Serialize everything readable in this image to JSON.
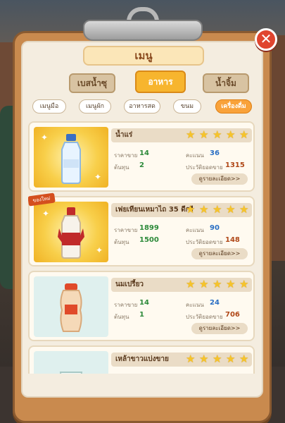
{
  "menu": {
    "title": "เมนู"
  },
  "tabs": [
    {
      "label": "เบสน้ำซุ"
    },
    {
      "label": "อาหาร"
    },
    {
      "label": "น้ำจิ้ม"
    }
  ],
  "active_tab": "อาหาร",
  "chips": [
    {
      "label": "เมนูมือ"
    },
    {
      "label": "เมนูผัก"
    },
    {
      "label": "อาหารสด"
    },
    {
      "label": "ขนม"
    },
    {
      "label": "เครื่องดื่ม"
    }
  ],
  "active_chip": "เครื่องดื่ม",
  "labels": {
    "price": "ราคาขาย",
    "cost": "ต้นทุน",
    "score": "คะแนน",
    "history": "ประวัติยอดขาย",
    "detail": "ดูรายละเอียด>>",
    "new_badge": "ของใหม่"
  },
  "items": [
    {
      "name": "น้ำแร่",
      "price": "14",
      "cost": "2",
      "score": "36",
      "sales": "1315",
      "stars": 5
    },
    {
      "name": "เฟยเทียนเหมาไถ 35 ดีกรี",
      "price": "1899",
      "cost": "1500",
      "score": "90",
      "sales": "148",
      "stars": 5
    },
    {
      "name": "นมเปรี้ยว",
      "price": "14",
      "cost": "1",
      "score": "24",
      "sales": "706",
      "stars": 5
    },
    {
      "name": "เหล้าขาวแบ่งขาย",
      "stars": 5
    }
  ],
  "colors": {
    "board": "#c98a4e",
    "paper": "#f4ede0",
    "accent": "#f7b52e",
    "star": "#f6c42a",
    "close": "#e0452f",
    "price_green": "#2d8a3a",
    "score_blue": "#2a6fc4",
    "sales_red": "#b04818"
  },
  "icons": {
    "close": "close-icon",
    "star": "star-icon",
    "water": "water-bottle-icon",
    "liquor": "liquor-bottle-icon",
    "yogurt": "yogurt-drink-icon",
    "glass": "glass-icon"
  }
}
